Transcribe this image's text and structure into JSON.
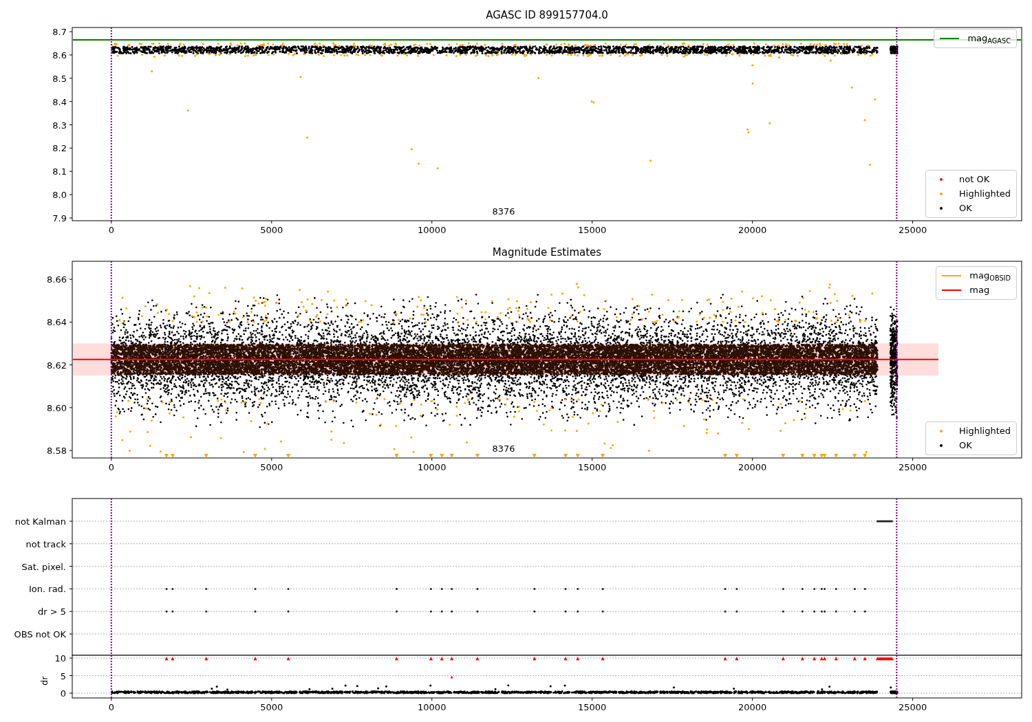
{
  "top_panel": {
    "chart_data": {
      "type": "scatter",
      "title": "AGASC ID 899157704.0",
      "xlim": [
        -1220,
        28400
      ],
      "ylim": [
        7.888,
        8.718
      ],
      "xticks": [
        0,
        5000,
        10000,
        15000,
        20000,
        25000
      ],
      "yticks": [
        {
          "value": 7.9,
          "label": "7.9"
        },
        {
          "value": 8.0,
          "label": "8.0"
        },
        {
          "value": 8.1,
          "label": "8.1"
        },
        {
          "value": 8.2,
          "label": "8.2"
        },
        {
          "value": 8.3,
          "label": "8.3"
        },
        {
          "value": 8.4,
          "label": "8.4"
        },
        {
          "value": 8.5,
          "label": "8.5"
        },
        {
          "value": 8.6,
          "label": "8.6"
        },
        {
          "value": 8.7,
          "label": "8.7"
        }
      ],
      "x": [
        -1220,
        28400
      ],
      "series": [
        {
          "name": "mag$_{AGASC}$",
          "type": "line",
          "color": "#008000",
          "values": [
            8.665,
            8.665
          ]
        }
      ],
      "ref_lines": [
        {
          "axis": "x",
          "value": 0,
          "color": "#800080"
        },
        {
          "axis": "x",
          "value": 24500,
          "color": "#800080"
        }
      ],
      "annotations": [
        "8376"
      ]
    },
    "legends": [
      {
        "entries": [
          {
            "label": "not OK",
            "kind": "marker",
            "color": "#ff0000"
          },
          {
            "label": "Highlighted",
            "kind": "marker",
            "color": "#ffa500"
          },
          {
            "label": "OK",
            "kind": "marker",
            "color": "#000000"
          }
        ]
      }
    ]
  },
  "middle_panel": {
    "chart_data": {
      "type": "scatter",
      "title": "Magnitude Estimates",
      "xlim": [
        -1220,
        28400
      ],
      "ylim": [
        8.5765,
        8.6684
      ],
      "xticks": [
        0,
        5000,
        10000,
        15000,
        20000,
        25000
      ],
      "yticks": [
        {
          "value": 8.58,
          "label": "8.58"
        },
        {
          "value": 8.6,
          "label": "8.60"
        },
        {
          "value": 8.62,
          "label": "8.62"
        },
        {
          "value": 8.64,
          "label": "8.64"
        },
        {
          "value": 8.66,
          "label": "8.66"
        }
      ],
      "x": [
        -1220,
        25800
      ],
      "series": [
        {
          "name": "mag",
          "type": "line",
          "color": "#ff0000",
          "values": [
            8.6225,
            8.6225
          ]
        }
      ],
      "bands": [
        {
          "axis": "y",
          "from": 8.615,
          "to": 8.63,
          "color": "#ffdddd"
        }
      ],
      "ref_lines": [
        {
          "axis": "x",
          "value": 0,
          "color": "#800080"
        },
        {
          "axis": "x",
          "value": 24500,
          "color": "#800080"
        }
      ],
      "annotations": [
        "8376"
      ]
    },
    "legends": [
      {
        "entries": [
          {
            "label": "mag$_{OBSID}$",
            "kind": "line",
            "color": "#ffa500"
          }
        ]
      },
      {
        "entries": [
          {
            "label": "Highlighted",
            "kind": "marker",
            "color": "#ffa500"
          },
          {
            "label": "OK",
            "kind": "marker",
            "color": "#000000"
          }
        ]
      }
    ]
  },
  "flags_panel": {
    "flags": [
      "not Kalman",
      "not track",
      "Sat. pixel.",
      "Ion. rad.",
      "dr > 5",
      "OBS not OK"
    ],
    "chart_data": {
      "type": "scatter",
      "ylabel": "dr",
      "xlim": [
        -1220,
        28400
      ],
      "ylim": [
        -1.37,
        10.8
      ],
      "xticks": [
        0,
        5000,
        10000,
        15000,
        20000,
        25000
      ],
      "yticks": [
        0,
        5,
        10
      ],
      "grid": true,
      "ref_lines": [
        {
          "axis": "x",
          "value": 0,
          "color": "#800080"
        },
        {
          "axis": "x",
          "value": 24500,
          "color": "#800080"
        }
      ]
    }
  }
}
